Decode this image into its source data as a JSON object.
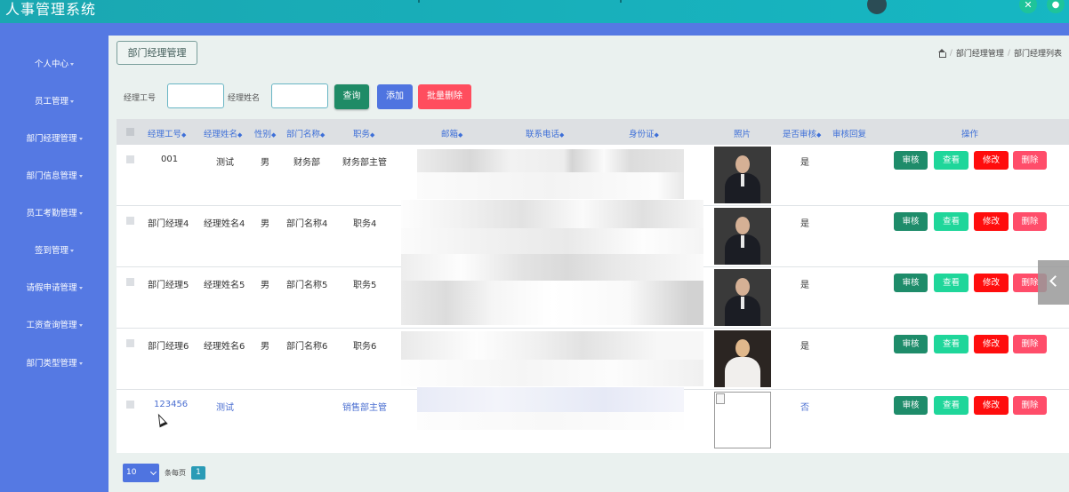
{
  "app": {
    "title": "人事管理系统"
  },
  "top_icons": [
    "user-avatar-icon",
    "expand-icon",
    "user-icon"
  ],
  "sidebar": {
    "items": [
      {
        "label": "个人中心"
      },
      {
        "label": "员工管理"
      },
      {
        "label": "部门经理管理"
      },
      {
        "label": "部门信息管理"
      },
      {
        "label": "员工考勤管理"
      },
      {
        "label": "签到管理"
      },
      {
        "label": "请假申请管理"
      },
      {
        "label": "工资查询管理"
      },
      {
        "label": "部门类型管理"
      }
    ]
  },
  "page": {
    "title": "部门经理管理",
    "breadcrumb": [
      "部门经理管理",
      "部门经理列表"
    ]
  },
  "filters": {
    "id_label": "经理工号",
    "id_value": "",
    "name_label": "经理姓名",
    "name_value": "",
    "search_button": "查询",
    "add_button": "添加",
    "batch_delete_button": "批量删除"
  },
  "table": {
    "columns": [
      "经理工号",
      "经理姓名",
      "性别",
      "部门名称",
      "职务",
      "邮箱",
      "联系电话",
      "身份证",
      "照片",
      "是否审核",
      "审核回复",
      "操作"
    ],
    "rows": [
      {
        "id": "001",
        "name": "测试",
        "gender": "男",
        "dept": "财务部",
        "position": "财务部主管",
        "audited": "是",
        "reply": ""
      },
      {
        "id": "部门经理4",
        "name": "经理姓名4",
        "gender": "男",
        "dept": "部门名称4",
        "position": "职务4",
        "audited": "是",
        "reply": ""
      },
      {
        "id": "部门经理5",
        "name": "经理姓名5",
        "gender": "男",
        "dept": "部门名称5",
        "position": "职务5",
        "audited": "是",
        "reply": ""
      },
      {
        "id": "部门经理6",
        "name": "经理姓名6",
        "gender": "男",
        "dept": "部门名称6",
        "position": "职务6",
        "audited": "是",
        "reply": ""
      },
      {
        "id": "123456",
        "name": "测试",
        "gender": "",
        "dept": "",
        "position": "销售部主管",
        "audited": "否",
        "reply": ""
      }
    ],
    "actions": {
      "audit": "审核",
      "view": "查看",
      "edit": "修改",
      "delete": "删除"
    }
  },
  "pagination": {
    "page_size": "10",
    "page_size_label": "条每页",
    "current_page": "1"
  },
  "colors": {
    "topbar": "#16b7c3",
    "sidebar": "#5579e3",
    "audit_button": "#1e8c6a",
    "view_button": "#1fd69a",
    "edit_button": "#ff0d0d",
    "delete_button": "#ff4d6a"
  }
}
